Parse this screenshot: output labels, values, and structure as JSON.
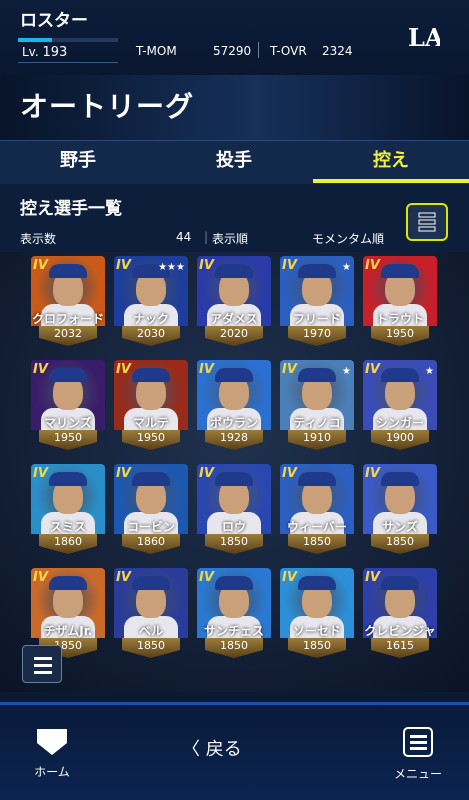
{
  "header": {
    "title": "ロスター",
    "level_label": "Lv.",
    "level": "193",
    "tmom_label": "T-MOM",
    "tmom": "57290",
    "tovr_label": "T-OVR",
    "tovr": "2324",
    "logo_text": "LA"
  },
  "page_title": "オートリーグ",
  "tabs": [
    {
      "label": "野手"
    },
    {
      "label": "投手"
    },
    {
      "label": "控え"
    }
  ],
  "section": {
    "title": "控え選手一覧",
    "count_label": "表示数",
    "count": "44",
    "order_label": "表示順",
    "order_value": "モメンタム順"
  },
  "colors": {
    "accent": "#f0f03a",
    "background": "#0b1a33",
    "iv": "#f6d642"
  },
  "players": [
    {
      "name": "クロフォード",
      "score": "2032",
      "grade": "IV"
    },
    {
      "name": "ナック",
      "score": "2030",
      "grade": "IV",
      "stars": "★★★"
    },
    {
      "name": "アダメス",
      "score": "2020",
      "grade": "IV"
    },
    {
      "name": "フリード",
      "score": "1970",
      "grade": "IV",
      "stars": "★"
    },
    {
      "name": "トラウト",
      "score": "1950",
      "grade": "IV"
    },
    {
      "name": "マリンズ",
      "score": "1950",
      "grade": "IV"
    },
    {
      "name": "マルテ",
      "score": "1950",
      "grade": "IV"
    },
    {
      "name": "ボウラン",
      "score": "1928",
      "grade": "IV"
    },
    {
      "name": "ティノコ",
      "score": "1910",
      "grade": "IV",
      "stars": "★"
    },
    {
      "name": "シンガー",
      "score": "1900",
      "grade": "IV",
      "stars": "★"
    },
    {
      "name": "スミス",
      "score": "1860",
      "grade": "IV"
    },
    {
      "name": "コービン",
      "score": "1860",
      "grade": "IV"
    },
    {
      "name": "ロウ",
      "score": "1850",
      "grade": "IV"
    },
    {
      "name": "ウィーバー",
      "score": "1850",
      "grade": "IV"
    },
    {
      "name": "サンズ",
      "score": "1850",
      "grade": "IV"
    },
    {
      "name": "チザムJr.",
      "score": "1850",
      "grade": "IV"
    },
    {
      "name": "ベル",
      "score": "1850",
      "grade": "IV"
    },
    {
      "name": "サンチェス",
      "score": "1850",
      "grade": "IV"
    },
    {
      "name": "ソーセド",
      "score": "1850",
      "grade": "IV"
    },
    {
      "name": "クレビンジャー",
      "score": "1615",
      "grade": "IV"
    }
  ],
  "footer": {
    "home": "ホーム",
    "back": "戻る",
    "menu": "メニュー"
  }
}
